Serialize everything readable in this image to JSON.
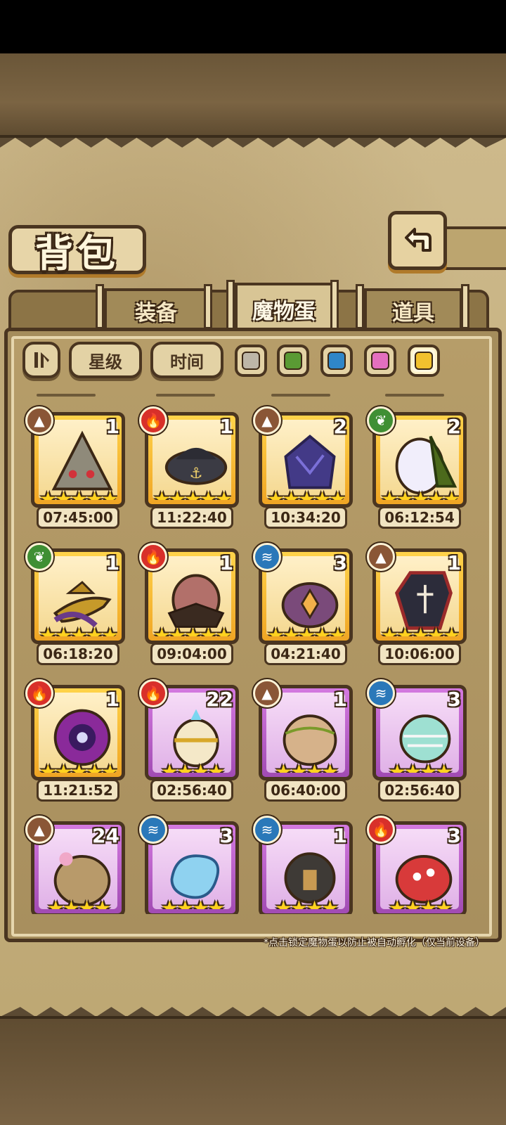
{
  "title": "背包",
  "tabs": [
    {
      "label": "装备",
      "active": false
    },
    {
      "label": "魔物蛋",
      "active": true
    },
    {
      "label": "道具",
      "active": false
    }
  ],
  "filters": {
    "sort_icon": "sort-toggle-icon",
    "star_label": "星级",
    "time_label": "时间",
    "swatches": [
      {
        "name": "gray",
        "color": "#bdb6a8"
      },
      {
        "name": "green",
        "color": "#5a9a34"
      },
      {
        "name": "blue",
        "color": "#2f86c8"
      },
      {
        "name": "pink",
        "color": "#e36fbf"
      },
      {
        "name": "yellow",
        "color": "#f2c12e",
        "selected": true
      }
    ]
  },
  "eggs": [
    {
      "element": "earth",
      "count": "1",
      "stars": 5,
      "rarity": "gold",
      "timer": "07:45:00"
    },
    {
      "element": "fire",
      "count": "1",
      "stars": 5,
      "rarity": "gold",
      "timer": "11:22:40"
    },
    {
      "element": "earth",
      "count": "2",
      "stars": 5,
      "rarity": "gold",
      "timer": "10:34:20"
    },
    {
      "element": "wood",
      "count": "2",
      "stars": 5,
      "rarity": "gold",
      "timer": "06:12:54"
    },
    {
      "element": "wood",
      "count": "1",
      "stars": 5,
      "rarity": "gold",
      "timer": "06:18:20"
    },
    {
      "element": "fire",
      "count": "1",
      "stars": 5,
      "rarity": "gold",
      "timer": "09:04:00"
    },
    {
      "element": "water",
      "count": "3",
      "stars": 5,
      "rarity": "gold",
      "timer": "04:21:40"
    },
    {
      "element": "earth",
      "count": "1",
      "stars": 5,
      "rarity": "gold",
      "timer": "10:06:00"
    },
    {
      "element": "fire",
      "count": "1",
      "stars": 5,
      "rarity": "gold",
      "timer": "11:21:52"
    },
    {
      "element": "fire",
      "count": "22",
      "stars": 4,
      "rarity": "purple",
      "timer": "02:56:40"
    },
    {
      "element": "earth",
      "count": "1",
      "stars": 4,
      "rarity": "purple",
      "timer": "06:40:00"
    },
    {
      "element": "water",
      "count": "3",
      "stars": 4,
      "rarity": "purple",
      "timer": "02:56:40"
    },
    {
      "element": "earth",
      "count": "24",
      "stars": 4,
      "rarity": "purple",
      "timer": ""
    },
    {
      "element": "water",
      "count": "3",
      "stars": 4,
      "rarity": "purple",
      "timer": ""
    },
    {
      "element": "water",
      "count": "1",
      "stars": 4,
      "rarity": "purple",
      "timer": ""
    },
    {
      "element": "fire",
      "count": "3",
      "stars": 4,
      "rarity": "purple",
      "timer": ""
    }
  ],
  "element_colors": {
    "fire": "#d8302a",
    "earth": "#8a5636",
    "wood": "#3f8f34",
    "water": "#2a78b9"
  },
  "hint_text": "*点击锁定魔物蛋以防止被自动孵化（仅当前设备）"
}
